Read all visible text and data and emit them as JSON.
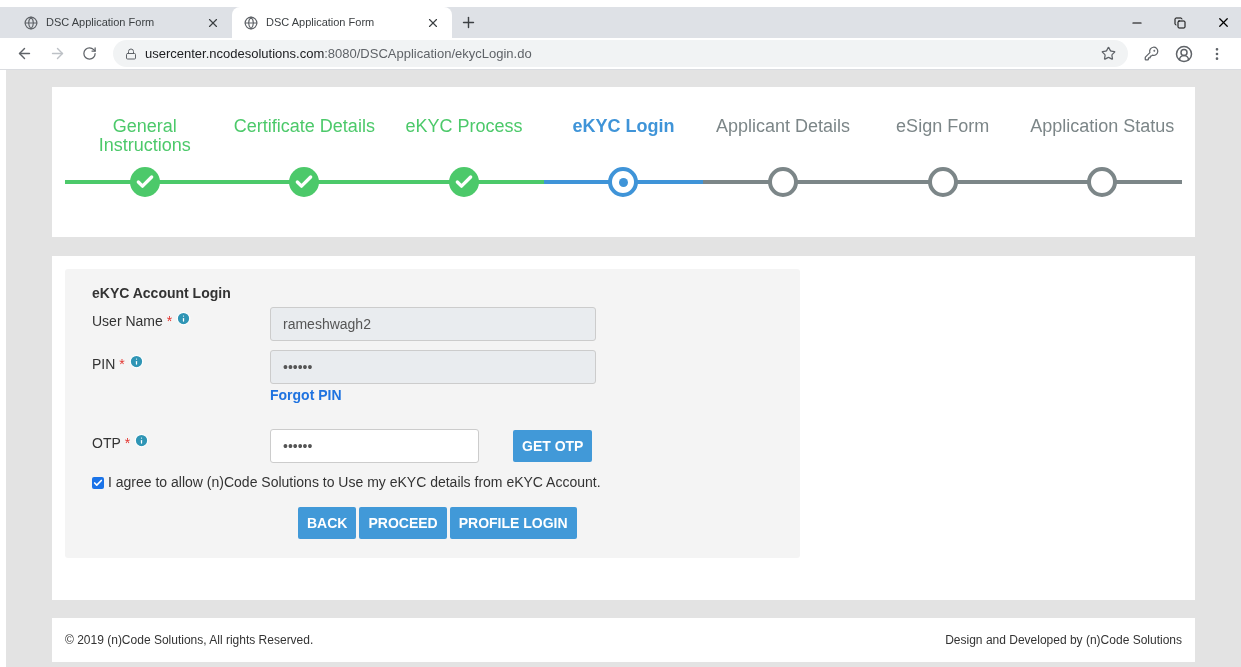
{
  "browser": {
    "tabs": [
      {
        "title": "DSC Application Form",
        "selected": false
      },
      {
        "title": "DSC Application Form",
        "selected": true
      }
    ],
    "url_host": "usercenter.ncodesolutions.com",
    "url_rest": ":8080/DSCApplication/ekycLogin.do"
  },
  "steps": [
    {
      "label": "General Instructions",
      "kind": "done"
    },
    {
      "label": "Certificate Details",
      "kind": "done"
    },
    {
      "label": "eKYC Process",
      "kind": "done"
    },
    {
      "label": "eKYC Login",
      "kind": "current"
    },
    {
      "label": "Applicant Details",
      "kind": "pending"
    },
    {
      "label": "eSign Form",
      "kind": "pending"
    },
    {
      "label": "Application Status",
      "kind": "pending"
    }
  ],
  "form": {
    "title": "eKYC Account Login",
    "fields": [
      {
        "label": "User Name",
        "required_mark": "*",
        "value": "rameshwagh2",
        "disabled": true
      },
      {
        "label": "PIN",
        "required_mark": "*",
        "value": "••••••",
        "disabled": true,
        "link": "Forgot PIN"
      },
      {
        "label": "OTP",
        "required_mark": "*",
        "value": "••••••",
        "disabled": false,
        "button": "GET OTP"
      }
    ],
    "consent": {
      "text": "I agree to allow (n)Code Solutions to Use my eKYC details from eKYC Account.",
      "checked": true
    },
    "buttons": [
      "BACK",
      "PROCEED",
      "PROFILE LOGIN"
    ]
  },
  "footer": {
    "left": "© 2019 (n)Code Solutions, All rights Reserved.",
    "right": "Design and Developed by (n)Code Solutions"
  }
}
